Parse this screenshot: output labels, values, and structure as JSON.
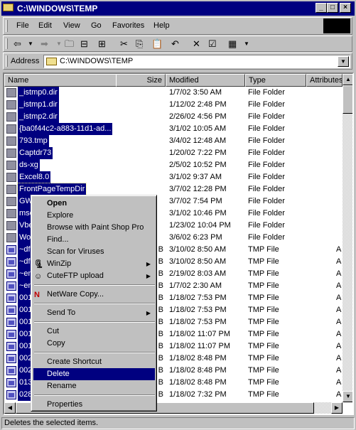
{
  "window": {
    "title": "C:\\WINDOWS\\TEMP"
  },
  "menubar": [
    "File",
    "Edit",
    "View",
    "Go",
    "Favorites",
    "Help"
  ],
  "address": {
    "label": "Address",
    "value": "C:\\WINDOWS\\TEMP"
  },
  "columns": [
    "Name",
    "Size",
    "Modified",
    "Type",
    "Attributes"
  ],
  "rows": [
    {
      "name": "_istmp0.dir",
      "size": "",
      "modified": "1/7/02 3:50 AM",
      "type": "File Folder",
      "attr": "",
      "icon": "folder"
    },
    {
      "name": "_istmp1.dir",
      "size": "",
      "modified": "1/12/02 2:48 PM",
      "type": "File Folder",
      "attr": "",
      "icon": "folder"
    },
    {
      "name": "_istmp2.dir",
      "size": "",
      "modified": "2/26/02 4:56 PM",
      "type": "File Folder",
      "attr": "",
      "icon": "folder"
    },
    {
      "name": "{ba0f44c2-a883-11d1-ad...",
      "size": "",
      "modified": "3/1/02 10:05 AM",
      "type": "File Folder",
      "attr": "",
      "icon": "folder"
    },
    {
      "name": "793.tmp",
      "size": "",
      "modified": "3/4/02 12:48 AM",
      "type": "File Folder",
      "attr": "",
      "icon": "folder"
    },
    {
      "name": "Captdr73",
      "size": "",
      "modified": "1/20/02 7:22 PM",
      "type": "File Folder",
      "attr": "",
      "icon": "folder"
    },
    {
      "name": "ds-xg",
      "size": "",
      "modified": "2/5/02 10:52 PM",
      "type": "File Folder",
      "attr": "",
      "icon": "folder"
    },
    {
      "name": "Excel8.0",
      "size": "",
      "modified": "3/1/02 9:37 AM",
      "type": "File Folder",
      "attr": "",
      "icon": "folder"
    },
    {
      "name": "FrontPageTempDir",
      "size": "",
      "modified": "3/7/02 12:28 PM",
      "type": "File Folder",
      "attr": "",
      "icon": "folder"
    },
    {
      "name": "GW",
      "size": "",
      "modified": "3/7/02 7:54 PM",
      "type": "File Folder",
      "attr": "",
      "icon": "folder"
    },
    {
      "name": "msc",
      "size": "",
      "modified": "3/1/02 10:46 PM",
      "type": "File Folder",
      "attr": "",
      "icon": "folder"
    },
    {
      "name": "Vbe",
      "size": "",
      "modified": "1/23/02 10:04 PM",
      "type": "File Folder",
      "attr": "",
      "icon": "folder"
    },
    {
      "name": "Wo",
      "size": "",
      "modified": "3/6/02 6:23 PM",
      "type": "File Folder",
      "attr": "",
      "icon": "folder"
    },
    {
      "name": "~df",
      "size": "B",
      "modified": "3/10/02 8:50 AM",
      "type": "TMP File",
      "attr": "A",
      "icon": "file"
    },
    {
      "name": "~df",
      "size": "B",
      "modified": "3/10/02 8:50 AM",
      "type": "TMP File",
      "attr": "A",
      "icon": "file"
    },
    {
      "name": "~en",
      "size": "B",
      "modified": "2/19/02 8:03 AM",
      "type": "TMP File",
      "attr": "A",
      "icon": "file"
    },
    {
      "name": "~en",
      "size": "B",
      "modified": "1/7/02 2:30 AM",
      "type": "TMP File",
      "attr": "A",
      "icon": "file"
    },
    {
      "name": "001",
      "size": "B",
      "modified": "1/18/02 7:53 PM",
      "type": "TMP File",
      "attr": "A",
      "icon": "file"
    },
    {
      "name": "001",
      "size": "B",
      "modified": "1/18/02 7:53 PM",
      "type": "TMP File",
      "attr": "A",
      "icon": "file"
    },
    {
      "name": "001",
      "size": "B",
      "modified": "1/18/02 7:53 PM",
      "type": "TMP File",
      "attr": "A",
      "icon": "file"
    },
    {
      "name": "001",
      "size": "B",
      "modified": "1/18/02 11:07 PM",
      "type": "TMP File",
      "attr": "A",
      "icon": "file"
    },
    {
      "name": "001",
      "size": "B",
      "modified": "1/18/02 11:07 PM",
      "type": "TMP File",
      "attr": "A",
      "icon": "file"
    },
    {
      "name": "002",
      "size": "B",
      "modified": "1/18/02 8:48 PM",
      "type": "TMP File",
      "attr": "A",
      "icon": "file"
    },
    {
      "name": "002",
      "size": "B",
      "modified": "1/18/02 8:48 PM",
      "type": "TMP File",
      "attr": "A",
      "icon": "file"
    },
    {
      "name": "013",
      "size": "B",
      "modified": "1/18/02 8:48 PM",
      "type": "TMP File",
      "attr": "A",
      "icon": "file"
    },
    {
      "name": "028",
      "size": "B",
      "modified": "1/18/02 7:32 PM",
      "type": "TMP File",
      "attr": "A",
      "icon": "file"
    }
  ],
  "context_menu": [
    {
      "label": "Open",
      "bold": true
    },
    {
      "label": "Explore"
    },
    {
      "label": "Browse with Paint Shop Pro"
    },
    {
      "label": "Find..."
    },
    {
      "label": "Scan for Viruses"
    },
    {
      "label": "WinZip",
      "submenu": true,
      "icon": "winzip-icon"
    },
    {
      "label": "CuteFTP upload",
      "submenu": true,
      "icon": "cuteftp-icon"
    },
    {
      "sep": true
    },
    {
      "label": "NetWare Copy...",
      "icon": "netware-icon"
    },
    {
      "sep": true
    },
    {
      "label": "Send To",
      "submenu": true
    },
    {
      "sep": true
    },
    {
      "label": "Cut"
    },
    {
      "label": "Copy"
    },
    {
      "sep": true
    },
    {
      "label": "Create Shortcut"
    },
    {
      "label": "Delete",
      "selected": true
    },
    {
      "label": "Rename"
    },
    {
      "sep": true
    },
    {
      "label": "Properties"
    }
  ],
  "status": "Deletes the selected items.",
  "colors": {
    "selection": "#000080",
    "face": "#c0c0c0"
  }
}
